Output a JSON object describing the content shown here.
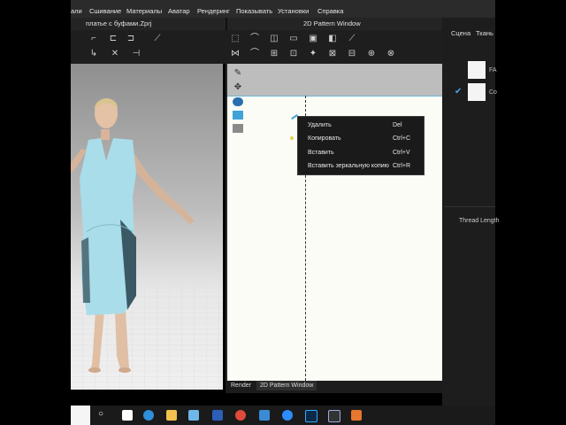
{
  "menubar": {
    "items": [
      "али",
      "Сшивание",
      "Материалы",
      "Аватар",
      "Рендеринг",
      "Показывать",
      "Установки",
      "Справка"
    ]
  },
  "windows": {
    "file_title": "платье с буфами.Zprj",
    "pattern_window_title": "2D Pattern Window"
  },
  "right_panel": {
    "tabs": [
      "Сцена",
      "Ткань"
    ],
    "fabric_labels": [
      "FA",
      "Co"
    ],
    "thread_length": "Thread Length"
  },
  "context_menu": {
    "items": [
      {
        "label": "Удалить",
        "shortcut": "Del"
      },
      {
        "label": "Копировать",
        "shortcut": "Ctrl+C"
      },
      {
        "label": "Вставить",
        "shortcut": "Ctrl+V"
      },
      {
        "label": "Вставить зеркальную копию",
        "shortcut": "Ctrl+R"
      }
    ]
  },
  "bottom_tabs": [
    "Render",
    "2D Pattern Window"
  ],
  "colors": {
    "accent": "#4aa3e8",
    "dress": "#a9dde9",
    "ui_dark": "#1e1e1e"
  },
  "taskbar": {
    "icons": [
      "start-icon",
      "search-icon",
      "yandex-icon",
      "edge-icon",
      "explorer-icon",
      "store-icon",
      "word-icon",
      "chrome-icon",
      "mail-icon",
      "zoom-icon",
      "photoshop-icon",
      "clo3d-icon",
      "app-icon"
    ]
  }
}
